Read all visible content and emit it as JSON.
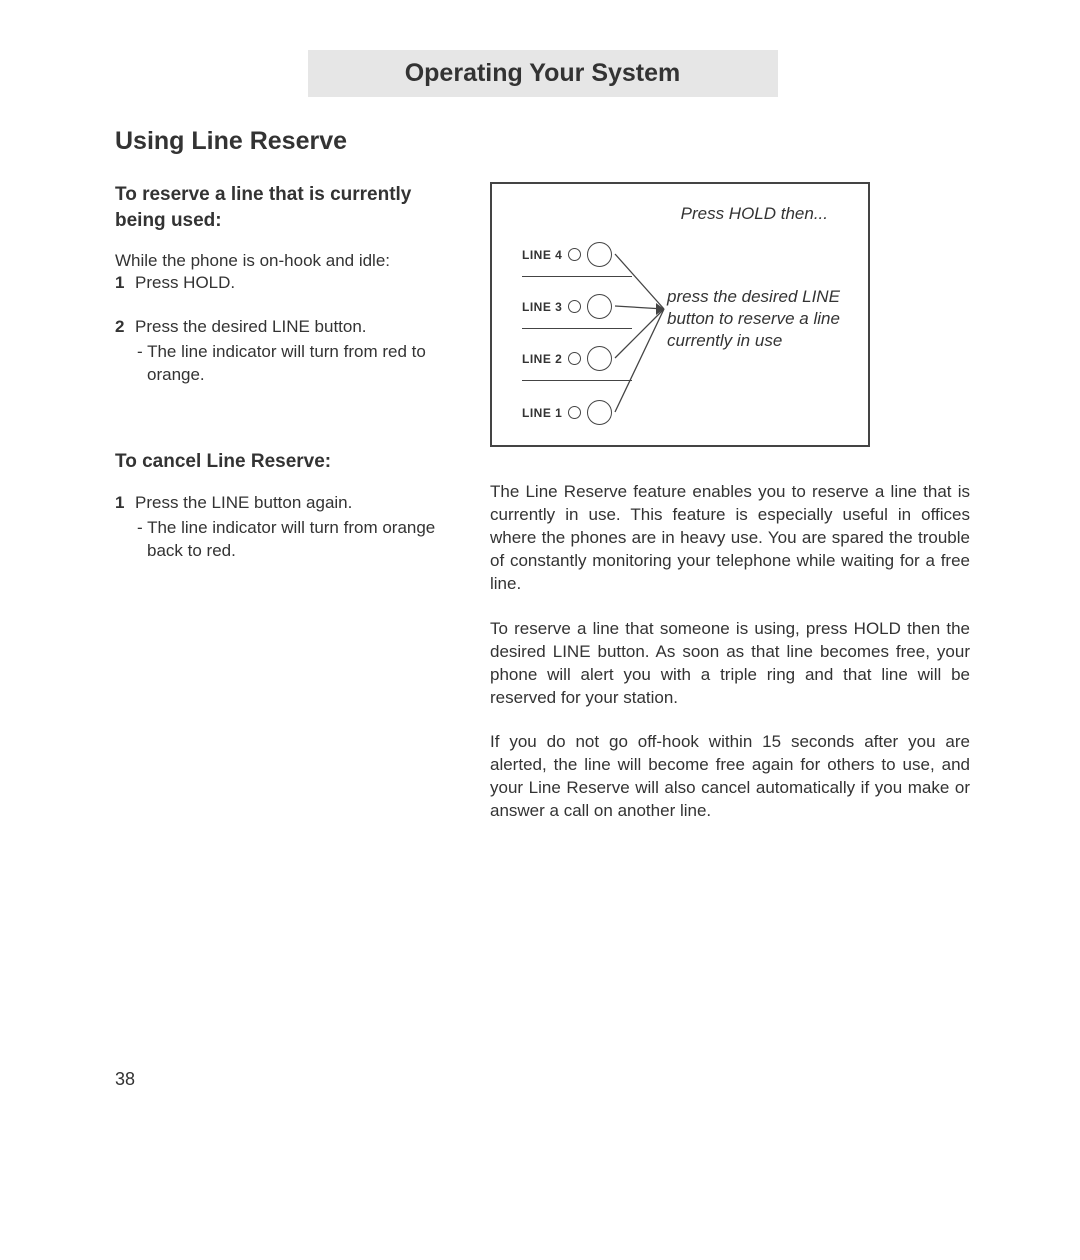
{
  "header": {
    "title": "Operating Your System"
  },
  "title": "Using Line Reserve",
  "left": {
    "section1": {
      "heading": "To reserve a line that is cur­rently being used:",
      "intro": "While the phone is on-hook and idle:",
      "step1_num": "1",
      "step1": "Press HOLD.",
      "step2_num": "2",
      "step2": "Press the desired LINE button.",
      "step2_sub": "- The line indicator will turn from red to orange."
    },
    "section2": {
      "heading": "To cancel Line Reserve:",
      "step1_num": "1",
      "step1": "Press the LINE button again.",
      "step1_sub": "- The line indicator will turn from orange back to red."
    }
  },
  "diagram": {
    "top_text": "Press HOLD then...",
    "lines": [
      "LINE 4",
      "LINE 3",
      "LINE 2",
      "LINE 1"
    ],
    "callout": "press the desired LINE button to reserve a line currently in use"
  },
  "right": {
    "para1": "The Line Reserve feature enables you to reserve a line that is currently in use.  This feature is especially useful in offices where the phones are in heavy use.  You are spared the trouble of con­stantly monitoring your telephone while waiting for a free line.",
    "para2": "To reserve a line that someone is using, press HOLD then the desired LINE button.  As soon as that line becomes free, your phone will alert you with a triple ring and that line will be reserved for your station.",
    "para3": "If you do not go off-hook within 15 seconds after you are alerted, the line will become free again for others to use, and your Line Reserve will also cancel automatically if you make or answer a call on another line."
  },
  "page_number": "38"
}
